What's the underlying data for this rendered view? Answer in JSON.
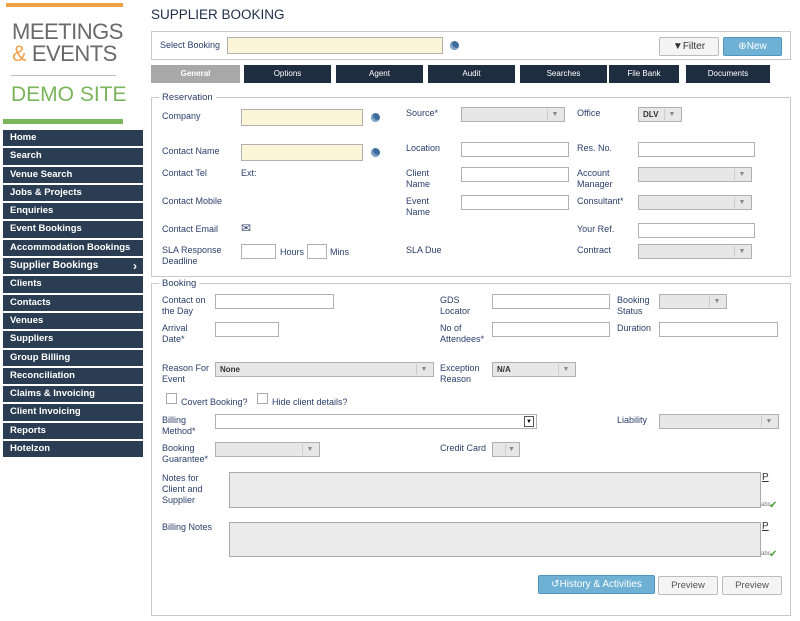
{
  "logo": {
    "line1": "MEETINGS",
    "amp": "&",
    "line2": "EVENTS",
    "demo": "DEMO SITE"
  },
  "colors": {
    "nav_bg": "#2b3d52",
    "accent_orange": "#f0a148",
    "accent_green": "#7ab55c",
    "tab_bg": "#1f2d40",
    "tab_active": "#a8a8a8",
    "button_blue": "#6fb1d4",
    "required_field": "#fcf5d7"
  },
  "nav": [
    {
      "label": "Home"
    },
    {
      "label": "Search"
    },
    {
      "label": "Venue Search"
    },
    {
      "label": "Jobs & Projects"
    },
    {
      "label": "Enquiries"
    },
    {
      "label": "Event Bookings"
    },
    {
      "label": "Accommodation Bookings"
    },
    {
      "label": "Supplier Bookings",
      "active": true
    },
    {
      "label": "Clients"
    },
    {
      "label": "Contacts"
    },
    {
      "label": "Venues"
    },
    {
      "label": "Suppliers"
    },
    {
      "label": "Group Billing"
    },
    {
      "label": "Reconciliation"
    },
    {
      "label": "Claims & Invoicing"
    },
    {
      "label": "Client Invoicing"
    },
    {
      "label": "Reports"
    },
    {
      "label": "Hotelzon"
    }
  ],
  "page": {
    "title": "SUPPLIER BOOKING",
    "select_booking_label": "Select Booking",
    "filter_label": "Filter",
    "new_label": "New"
  },
  "tabs": [
    {
      "label": "General",
      "active": true
    },
    {
      "label": "Options"
    },
    {
      "label": "Agent"
    },
    {
      "label": "Audit"
    },
    {
      "label": "Searches"
    },
    {
      "label": "File Bank"
    },
    {
      "label": "Documents"
    }
  ],
  "reservation": {
    "legend": "Reservation",
    "company": "Company",
    "contact_name": "Contact Name",
    "contact_tel": "Contact Tel",
    "ext": "Ext:",
    "contact_mobile": "Contact Mobile",
    "contact_email": "Contact Email",
    "sla_response_1": "SLA Response",
    "sla_response_2": "Deadline",
    "hours": "Hours",
    "mins": "Mins",
    "source": "Source*",
    "location": "Location",
    "client_name_1": "Client",
    "client_name_2": "Name",
    "event_name_1": "Event",
    "event_name_2": "Name",
    "sla_due": "SLA Due",
    "office": "Office",
    "office_value": "DLV",
    "res_no": "Res. No.",
    "account_manager_1": "Account",
    "account_manager_2": "Manager",
    "consultant": "Consultant*",
    "your_ref": "Your Ref.",
    "contract": "Contract"
  },
  "booking": {
    "legend": "Booking",
    "contact_on_day_1": "Contact on",
    "contact_on_day_2": "the Day",
    "arrival_date_1": "Arrival",
    "arrival_date_2": "Date*",
    "reason_for_event_1": "Reason For",
    "reason_for_event_2": "Event",
    "reason_value": "None",
    "covert_booking": "Covert Booking?",
    "hide_client": "Hide client details?",
    "billing_method_1": "Billing",
    "billing_method_2": "Method*",
    "booking_guarantee_1": "Booking",
    "booking_guarantee_2": "Guarantee*",
    "notes_1": "Notes for",
    "notes_2": "Client and",
    "notes_3": "Supplier",
    "billing_notes": "Billing Notes",
    "gds_locator_1": "GDS",
    "gds_locator_2": "Locator",
    "no_attendees_1": "No of",
    "no_attendees_2": "Attendees*",
    "exception_reason_1": "Exception",
    "exception_reason_2": "Reason",
    "exception_value": "N/A",
    "credit_card": "Credit Card",
    "booking_status_1": "Booking",
    "booking_status_2": "Status",
    "duration": "Duration",
    "liability": "Liability",
    "p_marker": "P",
    "abc": "abc"
  },
  "footer_buttons": {
    "history": "History & Activities",
    "preview1": "Preview",
    "preview2": "Preview"
  }
}
